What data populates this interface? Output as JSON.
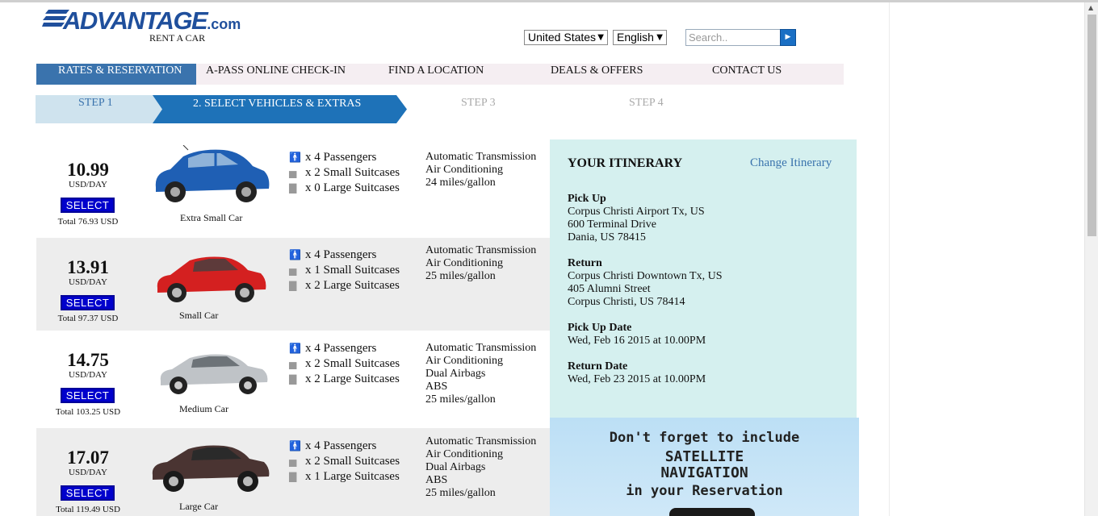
{
  "brand": {
    "logo_main": "ADVANTAGE",
    "logo_domain": ".com",
    "logo_sub": "RENT A CAR"
  },
  "header": {
    "country": "United States",
    "language": "English",
    "search_placeholder": "Search.."
  },
  "nav": [
    {
      "label": "RATES & RESERVATION"
    },
    {
      "label": "A-PASS ONLINE CHECK-IN"
    },
    {
      "label": "FIND A LOCATION"
    },
    {
      "label": "DEALS & OFFERS"
    },
    {
      "label": "CONTACT US"
    }
  ],
  "steps": [
    {
      "label": "STEP 1"
    },
    {
      "label": "2. SELECT VEHICLES & EXTRAS"
    },
    {
      "label": "STEP 3"
    },
    {
      "label": "STEP 4"
    }
  ],
  "cars": [
    {
      "price": "10.99",
      "per_day": "USD/DAY",
      "select": "SELECT",
      "total": "Total 76.93 USD",
      "name": "Extra Small Car",
      "passengers": "x 4 Passengers",
      "small": "x 2 Small Suitcases",
      "large": "x 0 Large Suitcases",
      "features": [
        "Automatic Transmission",
        "Air Conditioning",
        "24 miles/gallon"
      ],
      "color": "#1f5fb4"
    },
    {
      "price": "13.91",
      "per_day": "USD/DAY",
      "select": "SELECT",
      "total": "Total 97.37 USD",
      "name": "Small Car",
      "passengers": "x 4 Passengers",
      "small": "x 1 Small Suitcases",
      "large": "x 2 Large Suitcases",
      "features": [
        "Automatic Transmission",
        "Air Conditioning",
        "25 miles/gallon"
      ],
      "color": "#d42020"
    },
    {
      "price": "14.75",
      "per_day": "USD/DAY",
      "select": "SELECT",
      "total": "Total 103.25 USD",
      "name": "Medium Car",
      "passengers": "x 4 Passengers",
      "small": "x 2 Small Suitcases",
      "large": "x 2 Large Suitcases",
      "features": [
        "Automatic Transmission",
        "Air Conditioning",
        "Dual Airbags",
        "ABS",
        "25 miles/gallon"
      ],
      "color": "#bfc3c7"
    },
    {
      "price": "17.07",
      "per_day": "USD/DAY",
      "select": "SELECT",
      "total": "Total 119.49 USD",
      "name": "Large Car",
      "passengers": "x 4 Passengers",
      "small": "x 2 Small Suitcases",
      "large": "x 1 Large Suitcases",
      "features": [
        "Automatic Transmission",
        "Air Conditioning",
        "Dual Airbags",
        "ABS",
        "25 miles/gallon"
      ],
      "color": "#4a3432"
    }
  ],
  "itinerary": {
    "title": "YOUR ITINERARY",
    "change": "Change Itinerary",
    "pickup_label": "Pick Up",
    "pickup_lines": [
      "Corpus Christi Airport Tx, US",
      "600 Terminal Drive",
      "Dania, US 78415"
    ],
    "return_label": "Return",
    "return_lines": [
      "Corpus Christi Downtown Tx, US",
      "405 Alumni Street",
      "Corpus Christi, US 78414"
    ],
    "pickup_date_label": "Pick Up Date",
    "pickup_date": "Wed, Feb 16 2015 at 10.00PM",
    "return_date_label": "Return Date",
    "return_date": "Wed, Feb 23 2015 at 10.00PM"
  },
  "promo": {
    "line1": "Don't forget to include",
    "line2": "SATELLITE",
    "line3": "NAVIGATION",
    "line4": "in your Reservation"
  }
}
